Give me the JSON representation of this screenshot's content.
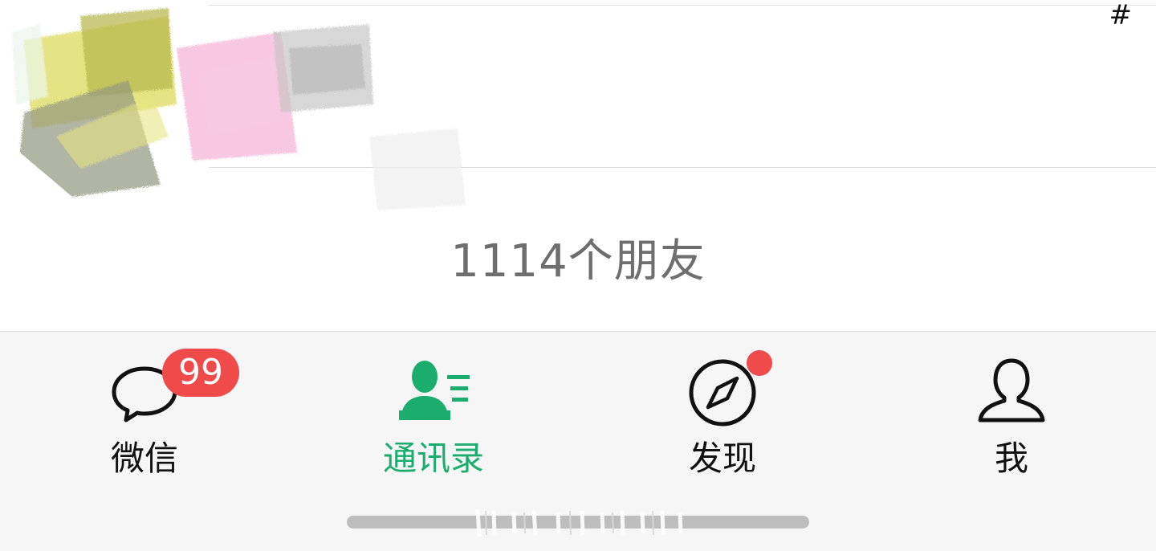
{
  "contacts": {
    "index_letter": "#",
    "friend_count_text": "1114个朋友"
  },
  "tabbar": {
    "tabs": [
      {
        "id": "chats",
        "label": "微信",
        "icon": "chat-bubble-icon",
        "badge": "99",
        "active": false
      },
      {
        "id": "contacts",
        "label": "通讯录",
        "icon": "contacts-icon",
        "active": true
      },
      {
        "id": "discover",
        "label": "发现",
        "icon": "compass-icon",
        "has_dot": true,
        "active": false
      },
      {
        "id": "me",
        "label": "我",
        "icon": "person-icon",
        "active": false
      }
    ]
  },
  "colors": {
    "accent_green": "#1aad6e",
    "badge_red": "#f04b4b",
    "tabbar_bg": "#f6f6f6",
    "muted_text": "#6e6e6e"
  }
}
